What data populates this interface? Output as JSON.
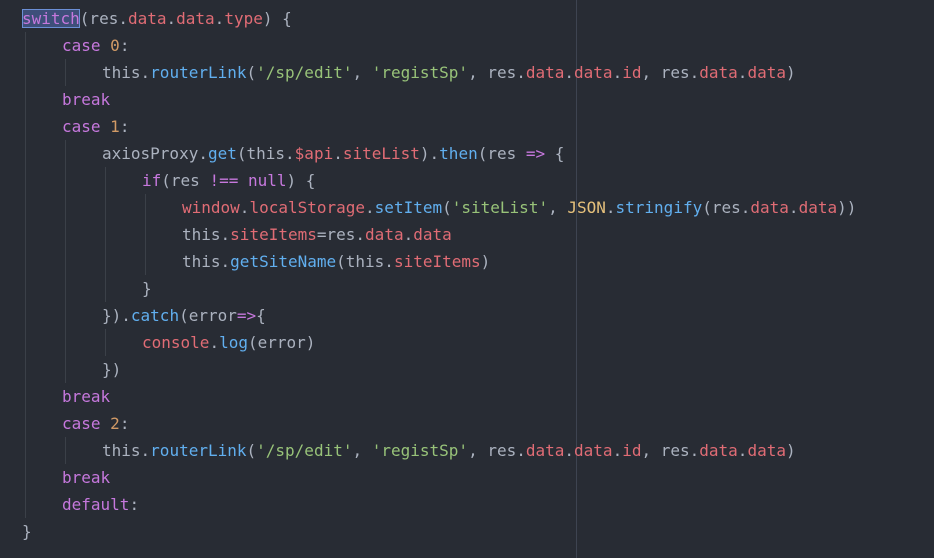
{
  "colors": {
    "background": "#282c34",
    "plain": "#abb2bf",
    "keyword": "#c678dd",
    "property": "#e06c75",
    "function": "#61afef",
    "string": "#98c379",
    "number": "#d19a66",
    "operator": "#56b6c2",
    "builtin": "#e5c07b",
    "highlight": "#3e4f7a"
  },
  "code": {
    "lines": [
      {
        "indent": 0,
        "tokens": [
          {
            "t": "switch",
            "c": "keyword",
            "hl": true
          },
          {
            "t": "(res.",
            "c": "plain"
          },
          {
            "t": "data",
            "c": "property"
          },
          {
            "t": ".",
            "c": "plain"
          },
          {
            "t": "data",
            "c": "property"
          },
          {
            "t": ".",
            "c": "plain"
          },
          {
            "t": "type",
            "c": "property"
          },
          {
            "t": ") {",
            "c": "plain"
          }
        ]
      },
      {
        "indent": 1,
        "tokens": [
          {
            "t": "case ",
            "c": "keyword"
          },
          {
            "t": "0",
            "c": "number"
          },
          {
            "t": ":",
            "c": "plain"
          }
        ]
      },
      {
        "indent": 2,
        "tokens": [
          {
            "t": "this.",
            "c": "plain"
          },
          {
            "t": "routerLink",
            "c": "function"
          },
          {
            "t": "(",
            "c": "plain"
          },
          {
            "t": "'/sp/edit'",
            "c": "string"
          },
          {
            "t": ", ",
            "c": "plain"
          },
          {
            "t": "'registSp'",
            "c": "string"
          },
          {
            "t": ", res.",
            "c": "plain"
          },
          {
            "t": "data",
            "c": "property"
          },
          {
            "t": ".",
            "c": "plain"
          },
          {
            "t": "data",
            "c": "property"
          },
          {
            "t": ".",
            "c": "plain"
          },
          {
            "t": "id",
            "c": "property"
          },
          {
            "t": ", res.",
            "c": "plain"
          },
          {
            "t": "data",
            "c": "property"
          },
          {
            "t": ".",
            "c": "plain"
          },
          {
            "t": "data",
            "c": "property"
          },
          {
            "t": ")",
            "c": "plain"
          }
        ]
      },
      {
        "indent": 1,
        "tokens": [
          {
            "t": "break",
            "c": "keyword"
          }
        ]
      },
      {
        "indent": 1,
        "tokens": [
          {
            "t": "case ",
            "c": "keyword"
          },
          {
            "t": "1",
            "c": "number"
          },
          {
            "t": ":",
            "c": "plain"
          }
        ]
      },
      {
        "indent": 2,
        "tokens": [
          {
            "t": "axiosProxy.",
            "c": "plain"
          },
          {
            "t": "get",
            "c": "function"
          },
          {
            "t": "(this.",
            "c": "plain"
          },
          {
            "t": "$api",
            "c": "property"
          },
          {
            "t": ".",
            "c": "plain"
          },
          {
            "t": "siteList",
            "c": "property"
          },
          {
            "t": ").",
            "c": "plain"
          },
          {
            "t": "then",
            "c": "function"
          },
          {
            "t": "(res ",
            "c": "plain"
          },
          {
            "t": "=>",
            "c": "keyword"
          },
          {
            "t": " {",
            "c": "plain"
          }
        ]
      },
      {
        "indent": 3,
        "tokens": [
          {
            "t": "if",
            "c": "keyword"
          },
          {
            "t": "(res ",
            "c": "plain"
          },
          {
            "t": "!==",
            "c": "keyword"
          },
          {
            "t": " ",
            "c": "plain"
          },
          {
            "t": "null",
            "c": "keyword"
          },
          {
            "t": ") {",
            "c": "plain"
          }
        ]
      },
      {
        "indent": 4,
        "tokens": [
          {
            "t": "window",
            "c": "property"
          },
          {
            "t": ".",
            "c": "plain"
          },
          {
            "t": "localStorage",
            "c": "property"
          },
          {
            "t": ".",
            "c": "plain"
          },
          {
            "t": "setItem",
            "c": "function"
          },
          {
            "t": "(",
            "c": "plain"
          },
          {
            "t": "'siteList'",
            "c": "string"
          },
          {
            "t": ", ",
            "c": "plain"
          },
          {
            "t": "JSON",
            "c": "builtin"
          },
          {
            "t": ".",
            "c": "plain"
          },
          {
            "t": "stringify",
            "c": "function"
          },
          {
            "t": "(res.",
            "c": "plain"
          },
          {
            "t": "data",
            "c": "property"
          },
          {
            "t": ".",
            "c": "plain"
          },
          {
            "t": "data",
            "c": "property"
          },
          {
            "t": "))",
            "c": "plain"
          }
        ]
      },
      {
        "indent": 4,
        "tokens": [
          {
            "t": "this.",
            "c": "plain"
          },
          {
            "t": "siteItems",
            "c": "property"
          },
          {
            "t": "=res.",
            "c": "plain"
          },
          {
            "t": "data",
            "c": "property"
          },
          {
            "t": ".",
            "c": "plain"
          },
          {
            "t": "data",
            "c": "property"
          }
        ]
      },
      {
        "indent": 4,
        "tokens": [
          {
            "t": "this.",
            "c": "plain"
          },
          {
            "t": "getSiteName",
            "c": "function"
          },
          {
            "t": "(this.",
            "c": "plain"
          },
          {
            "t": "siteItems",
            "c": "property"
          },
          {
            "t": ")",
            "c": "plain"
          }
        ]
      },
      {
        "indent": 3,
        "tokens": [
          {
            "t": "}",
            "c": "plain"
          }
        ]
      },
      {
        "indent": 2,
        "tokens": [
          {
            "t": "}).",
            "c": "plain"
          },
          {
            "t": "catch",
            "c": "function"
          },
          {
            "t": "(error",
            "c": "plain"
          },
          {
            "t": "=>",
            "c": "keyword"
          },
          {
            "t": "{",
            "c": "plain"
          }
        ]
      },
      {
        "indent": 3,
        "tokens": [
          {
            "t": "console",
            "c": "property"
          },
          {
            "t": ".",
            "c": "plain"
          },
          {
            "t": "log",
            "c": "function"
          },
          {
            "t": "(error)",
            "c": "plain"
          }
        ]
      },
      {
        "indent": 2,
        "tokens": [
          {
            "t": "})",
            "c": "plain"
          }
        ]
      },
      {
        "indent": 1,
        "tokens": [
          {
            "t": "break",
            "c": "keyword"
          }
        ]
      },
      {
        "indent": 1,
        "tokens": [
          {
            "t": "case ",
            "c": "keyword"
          },
          {
            "t": "2",
            "c": "number"
          },
          {
            "t": ":",
            "c": "plain"
          }
        ]
      },
      {
        "indent": 2,
        "tokens": [
          {
            "t": "this.",
            "c": "plain"
          },
          {
            "t": "routerLink",
            "c": "function"
          },
          {
            "t": "(",
            "c": "plain"
          },
          {
            "t": "'/sp/edit'",
            "c": "string"
          },
          {
            "t": ", ",
            "c": "plain"
          },
          {
            "t": "'registSp'",
            "c": "string"
          },
          {
            "t": ", res.",
            "c": "plain"
          },
          {
            "t": "data",
            "c": "property"
          },
          {
            "t": ".",
            "c": "plain"
          },
          {
            "t": "data",
            "c": "property"
          },
          {
            "t": ".",
            "c": "plain"
          },
          {
            "t": "id",
            "c": "property"
          },
          {
            "t": ", res.",
            "c": "plain"
          },
          {
            "t": "data",
            "c": "property"
          },
          {
            "t": ".",
            "c": "plain"
          },
          {
            "t": "data",
            "c": "property"
          },
          {
            "t": ")",
            "c": "plain"
          }
        ]
      },
      {
        "indent": 1,
        "tokens": [
          {
            "t": "break",
            "c": "keyword"
          }
        ]
      },
      {
        "indent": 1,
        "tokens": [
          {
            "t": "default",
            "c": "keyword"
          },
          {
            "t": ":",
            "c": "plain"
          }
        ]
      },
      {
        "indent": 0,
        "tokens": [
          {
            "t": "}",
            "c": "plain"
          }
        ]
      }
    ]
  }
}
